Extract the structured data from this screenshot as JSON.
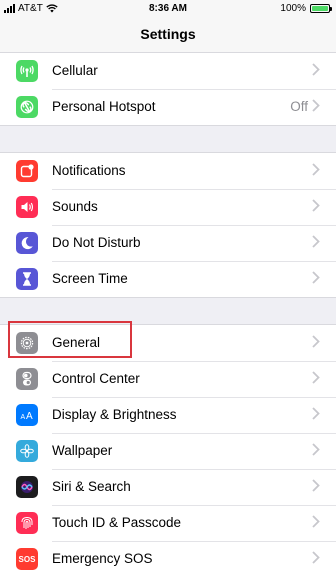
{
  "status": {
    "carrier": "AT&T",
    "time": "8:36 AM",
    "battery_percent": "100%",
    "battery_level": 1.0
  },
  "nav": {
    "title": "Settings"
  },
  "groups": [
    {
      "items": [
        {
          "label": "Cellular",
          "icon": "cellular-icon",
          "color": "#4cd964"
        },
        {
          "label": "Personal Hotspot",
          "value": "Off",
          "icon": "hotspot-icon",
          "color": "#4cd964"
        }
      ]
    },
    {
      "items": [
        {
          "label": "Notifications",
          "icon": "notifications-icon",
          "color": "#ff3b30"
        },
        {
          "label": "Sounds",
          "icon": "speaker-icon",
          "color": "#ff2d55"
        },
        {
          "label": "Do Not Disturb",
          "icon": "moon-icon",
          "color": "#5856d6"
        },
        {
          "label": "Screen Time",
          "icon": "hourglass-icon",
          "color": "#5856d6"
        }
      ]
    },
    {
      "items": [
        {
          "label": "General",
          "icon": "gear-icon",
          "color": "#8e8e93"
        },
        {
          "label": "Control Center",
          "icon": "toggles-icon",
          "color": "#8e8e93"
        },
        {
          "label": "Display & Brightness",
          "icon": "text-size-icon",
          "color": "#007aff"
        },
        {
          "label": "Wallpaper",
          "icon": "flower-icon",
          "color": "#34aadc"
        },
        {
          "label": "Siri & Search",
          "icon": "siri-icon",
          "color": "#1c1c1e"
        },
        {
          "label": "Touch ID & Passcode",
          "icon": "fingerprint-icon",
          "color": "#ff2d55"
        },
        {
          "label": "Emergency SOS",
          "icon": "sos-icon",
          "color": "#ff3b30",
          "icon_text": "SOS"
        }
      ]
    }
  ]
}
